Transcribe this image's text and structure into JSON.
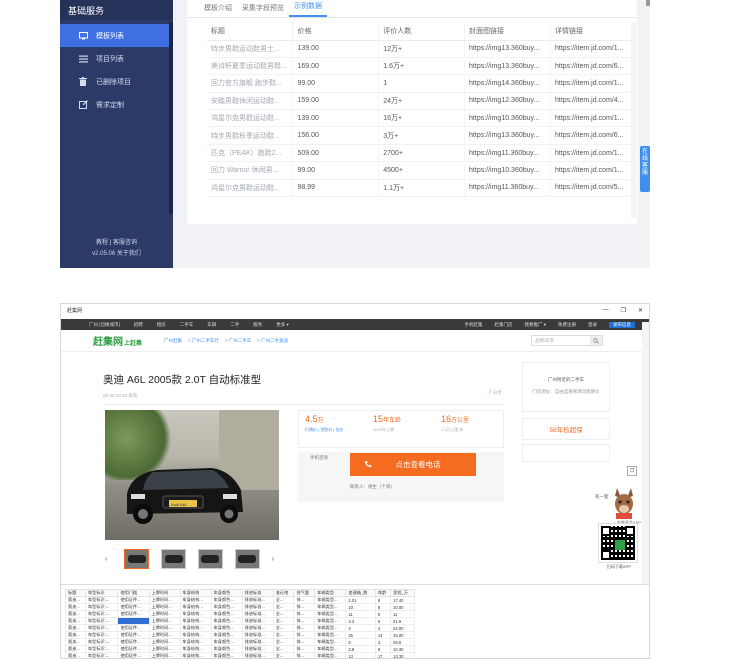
{
  "admin": {
    "sidebar_title": "基础服务",
    "menu": [
      {
        "label": "模板列表",
        "icon": "dashboard-icon",
        "active": true
      },
      {
        "label": "项目列表",
        "icon": "list-icon",
        "active": false
      },
      {
        "label": "已删除项目",
        "icon": "trash-icon",
        "active": false
      },
      {
        "label": "需求定制",
        "icon": "edit-icon",
        "active": false
      }
    ],
    "footer_line1": "教程 | 客服咨询",
    "footer_line2": "v2.05.06 关于我们",
    "tabs": [
      {
        "label": "模板介绍",
        "active": false
      },
      {
        "label": "采集字段预览",
        "active": false
      },
      {
        "label": "示例数据",
        "active": true
      }
    ],
    "columns": [
      "标题",
      "价格",
      "评价人数",
      "封面图链接",
      "详情链接"
    ],
    "rows": [
      [
        "特步男鞋运动鞋男士...",
        "139.00",
        "12万+",
        "https://img13.360buy...",
        "https://item.jd.com/1..."
      ],
      [
        "美诗轩夏季运动鞋男鞋...",
        "169.00",
        "1.6万+",
        "https://img13.360buy...",
        "https://item.jd.com/6..."
      ],
      [
        "回力官方旗舰 跑步鞋...",
        "99.00",
        "1",
        "https://img14.360buy...",
        "https://item.jd.com/1..."
      ],
      [
        "安踏男鞋休闲运动鞋...",
        "159.00",
        "24万+",
        "https://img12.360buy...",
        "https://item.jd.com/4..."
      ],
      [
        "鸿星尔克男鞋运动鞋...",
        "139.00",
        "16万+",
        "https://img10.360buy...",
        "https://item.jd.com/1..."
      ],
      [
        "特步男鞋秋季运动鞋...",
        "156.00",
        "3万+",
        "https://img13.360buy...",
        "https://item.jd.com/6..."
      ],
      [
        "匹克（PEAK）跑鞋2...",
        "509.00",
        "2700+",
        "https://img11.360buy...",
        "https://item.jd.com/1..."
      ],
      [
        "回力 Warrior 休闲男...",
        "99.00",
        "4500+",
        "https://img10.360buy...",
        "https://item.jd.com/1..."
      ],
      [
        "鸿星尔克男鞋运动鞋...",
        "98.99",
        "1.1万+",
        "https://img11.360buy...",
        "https://item.jd.com/5..."
      ]
    ],
    "float_tab": "在线客服"
  },
  "browser": {
    "window_title": "赶集网",
    "window_buttons": [
      "—",
      "❐",
      "✕"
    ],
    "topnav_left": [
      "广州 [切换城市]",
      "招聘",
      "租房",
      "二手车",
      "车辆",
      "二手",
      "服务",
      "更多 ▾"
    ],
    "topnav_right": [
      "手机赶集",
      "赶集门店",
      "我要推广 ▾",
      "免费注册",
      "登录",
      "发布信息"
    ],
    "brand": "赶集网",
    "brand_sub": "上赶集",
    "breadcrumbs": [
      "广州赶集",
      "> 广州二手车行",
      "> 广州二手车",
      "> 广州二手奥迪"
    ],
    "search_placeholder": "品牌/车系",
    "car_title": "奥迪 A6L 2005款 2.0T 自动标准型",
    "post_date": "05-22 20:33 发布",
    "share": "分享",
    "plate": "Audi A6L",
    "prices": [
      {
        "value": "4.5",
        "unit": "万",
        "label": "行情价 | 贷款价 | 估价"
      },
      {
        "value": "15",
        "unit": "年车龄",
        "label": "2016年上牌"
      },
      {
        "value": "16",
        "unit": "万公里",
        "label": "1.1万公里/年"
      }
    ],
    "call_label": "手机咨询",
    "call_button": "点击查看电话",
    "contact": "联系人：谢生（个商）",
    "right_box_title": "广州附近的二手车",
    "right_box_sub": "门店地址：自由选择来源可能降价",
    "right_box_link": "58年检超保",
    "mascot_bubble": "有一套",
    "mascot_label": "赶集直卖APP",
    "qr_caption": "扫码下载APP",
    "table_columns": [
      "标题",
      "车型标识",
      "使用门槛",
      "上牌时间",
      "车身结构",
      "车身颜色",
      "排放标准",
      "准迁地",
      "排气量",
      "车辆类型",
      "变速箱_数",
      "车龄",
      "里程_万"
    ],
    "table_rows": [
      [
        "奥迪...",
        "车型标识:...",
        "使用证件...",
        "上牌时间...",
        "车身结构...",
        "车身颜色...",
        "排放标准...",
        "全...",
        "排...",
        "车辆类型...",
        "2.01",
        "8",
        "17.40"
      ],
      [
        "奥迪...",
        "车型标识:...",
        "使用证件...",
        "上牌时间...",
        "车身结构...",
        "车身颜色...",
        "排放标准...",
        "全...",
        "排...",
        "车辆类型...",
        "10",
        "8",
        "10.00"
      ],
      [
        "奥迪...",
        "车型标识:...",
        "使用证件...",
        "上牌时间...",
        "车身结构...",
        "车身颜色...",
        "排放标准...",
        "全...",
        "排...",
        "车辆类型...",
        "11",
        "5",
        "11"
      ],
      [
        "奥迪...",
        "车型标识:...",
        "",
        "上牌时间...",
        "车身结构...",
        "车身颜色...",
        "排放标准...",
        "全...",
        "排...",
        "车辆类型...",
        "3.3",
        "9",
        "21.9"
      ],
      [
        "奥迪...",
        "车型标识:...",
        "使用证件...",
        "上牌时间...",
        "车身结构...",
        "车身颜色...",
        "排放标准...",
        "全...",
        "排...",
        "车辆类型...",
        "4",
        "4",
        "24.00"
      ],
      [
        "奥迪...",
        "车型标识:...",
        "使用证件...",
        "上牌时间...",
        "车身结构...",
        "车身颜色...",
        "排放标准...",
        "全...",
        "排...",
        "车辆类型...",
        "25",
        "14",
        "15.00"
      ],
      [
        "奥迪...",
        "车型标识:...",
        "使用证件...",
        "上牌时间...",
        "车身结构...",
        "车身颜色...",
        "排放标准...",
        "全...",
        "排...",
        "车辆类型...",
        "5",
        "3",
        "25.8"
      ],
      [
        "奥迪...",
        "车型标识:...",
        "使用证件...",
        "上牌时间...",
        "车身结构...",
        "车身颜色...",
        "排放标准...",
        "全...",
        "排...",
        "车辆类型...",
        "3.8",
        "8",
        "10.30"
      ],
      [
        "奥迪...",
        "车型标识:...",
        "使用证件...",
        "上牌时间...",
        "车身结构...",
        "车身颜色...",
        "排放标准...",
        "全...",
        "排...",
        "车辆类型...",
        "13",
        "17",
        "13.30"
      ],
      [
        "奥迪...",
        "车型标识:...",
        "使用证件...",
        "上牌时间...",
        "车身结构...",
        "车身颜色...",
        "排放标准...",
        "全...",
        "排...",
        "车辆类型...",
        "10",
        "16",
        "16.8"
      ],
      [
        "奥迪...",
        "车型标识:...",
        "使用证件...",
        "上牌时间...",
        "车身结构...",
        "车身颜色...",
        "排放标准...",
        "全...",
        "排...",
        "车辆类型...",
        "12.9",
        "9",
        "24.00"
      ],
      [
        "奥迪...",
        "车型标识:...",
        "使用证件...",
        "上牌时间...",
        "车身结构...",
        "车身颜色...",
        "排放标准...",
        "全...",
        "排...",
        "车辆类型...",
        "3.8",
        "8",
        "24.00"
      ]
    ]
  },
  "colors": {
    "sidebar_bg": "#2b3a67",
    "sidebar_active": "#3f6fe0",
    "accent_blue": "#3f8ff0",
    "brand_green": "#2ea043",
    "orange": "#f56b1f"
  }
}
